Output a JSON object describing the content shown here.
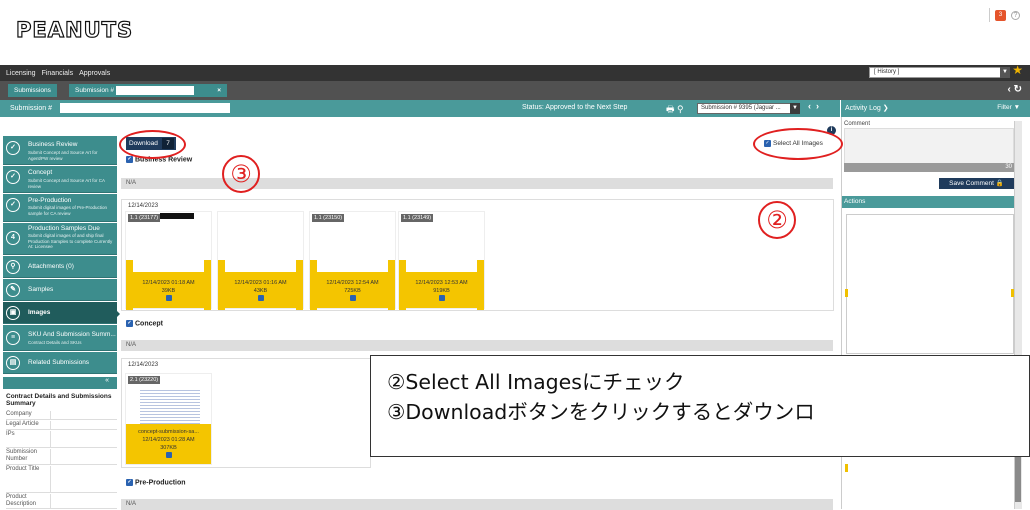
{
  "header": {
    "logo": "PEANUTS",
    "notif_count": "3",
    "help": "?"
  },
  "topnav": {
    "items": [
      "Licensing",
      "Financials",
      "Approvals"
    ],
    "history_value": "[ History ]"
  },
  "tabs": {
    "tab1": "Submissions",
    "tab2": "Submission #"
  },
  "subbar": {
    "label": "Submission #",
    "status": "Status: Approved to the Next Step",
    "select_value": "Submission # 9395 (Jaguar ..."
  },
  "activity": {
    "title": "Activity Log ❯",
    "filter": "Filter",
    "comment_label": "Comment",
    "count": "30",
    "save_comment": "Save Comment",
    "actions": "Actions"
  },
  "sidebar": {
    "items": [
      {
        "title": "Business Review",
        "sub": "Submit Concept and Source Art for Agent/PW review"
      },
      {
        "title": "Concept",
        "sub": "Submit Concept and Source Art for CA review"
      },
      {
        "title": "Pre-Production",
        "sub": "Submit digital images of Pre-Production sample for CA review"
      },
      {
        "title": "Production Samples Due",
        "sub": "Submit digital images of and ship final Production Samples to complete Currently At: Licensee",
        "num": "4"
      },
      {
        "title": "Attachments (0)",
        "sub": ""
      },
      {
        "title": "Samples",
        "sub": ""
      },
      {
        "title": "Images",
        "sub": ""
      },
      {
        "title": "SKU And Submission Summ...",
        "sub": "Contract Details and SKUs"
      },
      {
        "title": "Related Submissions",
        "sub": ""
      }
    ],
    "contract_title": "Contract Details and Submissions Summary",
    "contract_labels": [
      "Company",
      "Legal Article",
      "IPs",
      "Submission Number",
      "Product Title",
      "Product Description"
    ]
  },
  "main": {
    "download_label": "Download",
    "download_count": "7",
    "select_all": "Select All Images",
    "sections": [
      {
        "title": "Business Review",
        "na": "N/A",
        "date": "12/14/2023",
        "images": [
          {
            "id": "1.1 (23177)",
            "date": "12/14/2023 01:18 AM",
            "size": "39KB"
          },
          {
            "id": "",
            "date": "12/14/2023 01:16 AM",
            "size": "43KB"
          },
          {
            "id": "1.1 (23150)",
            "date": "12/14/2023 12:54 AM",
            "size": "725KB"
          },
          {
            "id": "1.1 (23149)",
            "date": "12/14/2023 12:53 AM",
            "size": "919KB"
          }
        ]
      },
      {
        "title": "Concept",
        "na": "N/A",
        "date": "12/14/2023",
        "images": [
          {
            "id": "2.1 (23220)",
            "name": "concept-submission-sa...",
            "date": "12/14/2023 01:28 AM",
            "size": "307KB"
          }
        ]
      },
      {
        "title": "Pre-Production",
        "na": "N/A"
      }
    ]
  },
  "annotations": {
    "marker2": "②",
    "marker3": "③",
    "line1": "②Select All Imagesにチェック",
    "line2": "③Downloadボタンをクリックするとダウンロ"
  },
  "colors": {
    "teal": "#3d8d8d",
    "navy": "#1f3b5c",
    "yellow": "#f4c500",
    "red": "#e02020"
  }
}
